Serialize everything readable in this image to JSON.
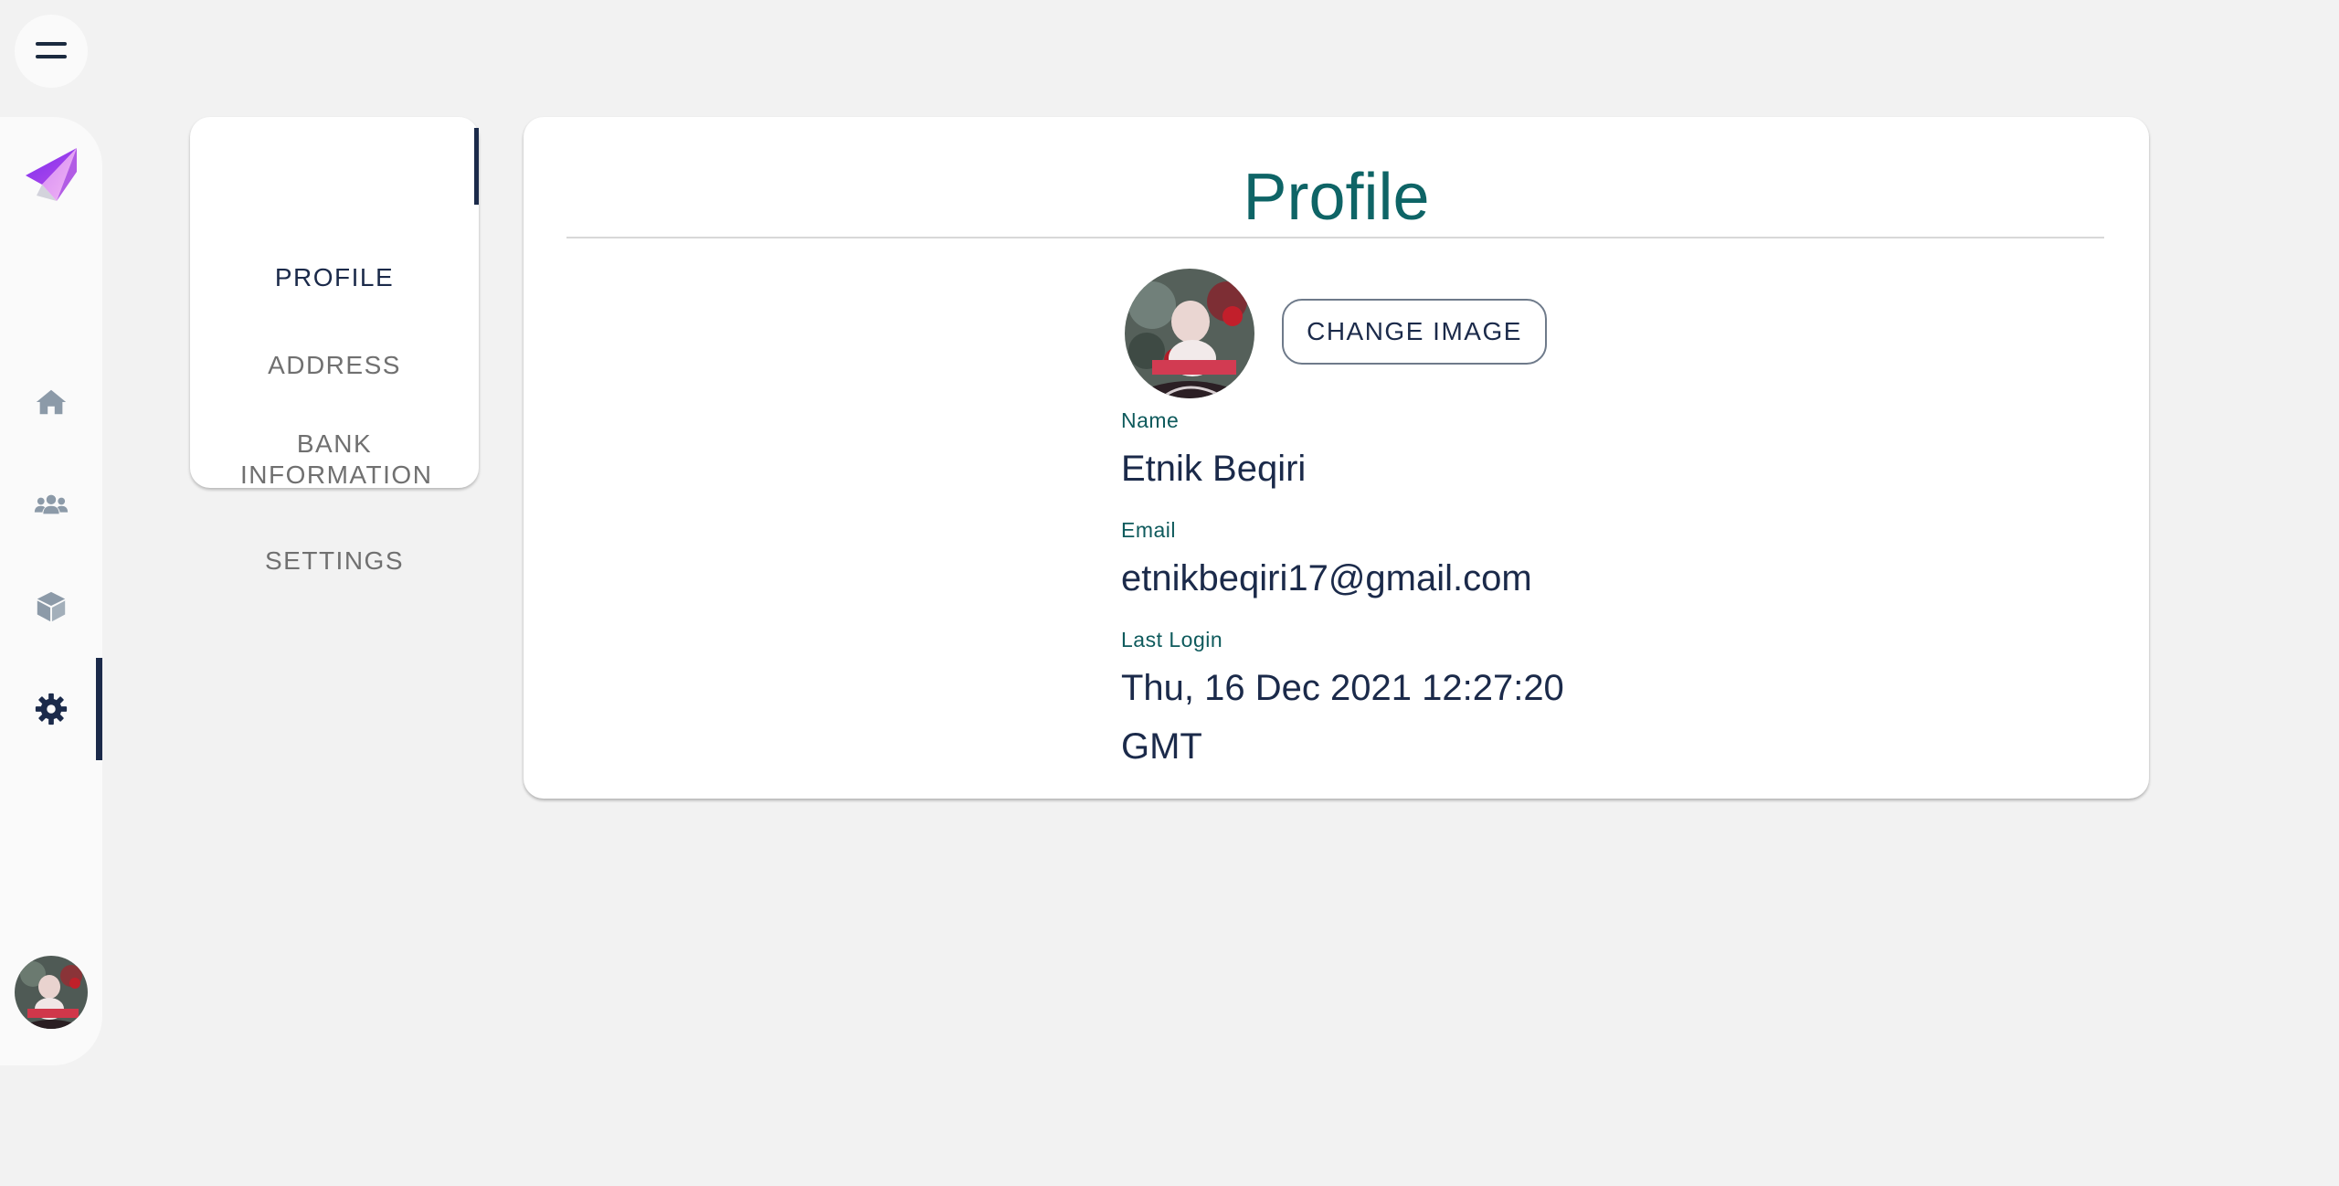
{
  "colors": {
    "background": "#f2f2f2",
    "rail_background": "#fafafa",
    "navy": "#1b2a4a",
    "teal": "#0e6466",
    "icon_inactive": "#8c9aa8",
    "logo_gradient": [
      "#8a2be2",
      "#e79bf0"
    ]
  },
  "topbar": {
    "menu_icon": "hamburger-icon"
  },
  "rail": {
    "logo_icon": "paper-plane-logo",
    "items": [
      {
        "icon": "home-icon",
        "active": false
      },
      {
        "icon": "users-icon",
        "active": false
      },
      {
        "icon": "cube-icon",
        "active": false
      },
      {
        "icon": "gear-icon",
        "active": true
      }
    ],
    "avatar_icon": "user-avatar"
  },
  "subnav": {
    "items": [
      {
        "label": "PROFILE",
        "active": true
      },
      {
        "label": "ADDRESS",
        "active": false
      },
      {
        "label": "BANK INFORMATION",
        "active": false
      },
      {
        "label": "SETTINGS",
        "active": false
      }
    ]
  },
  "profile": {
    "title": "Profile",
    "change_image_label": "CHANGE IMAGE",
    "fields": [
      {
        "label": "Name",
        "value": "Etnik Beqiri"
      },
      {
        "label": "Email",
        "value": "etnikbeqiri17@gmail.com"
      },
      {
        "label": "Last Login",
        "value": "Thu, 16 Dec 2021 12:27:20 GMT"
      }
    ]
  }
}
